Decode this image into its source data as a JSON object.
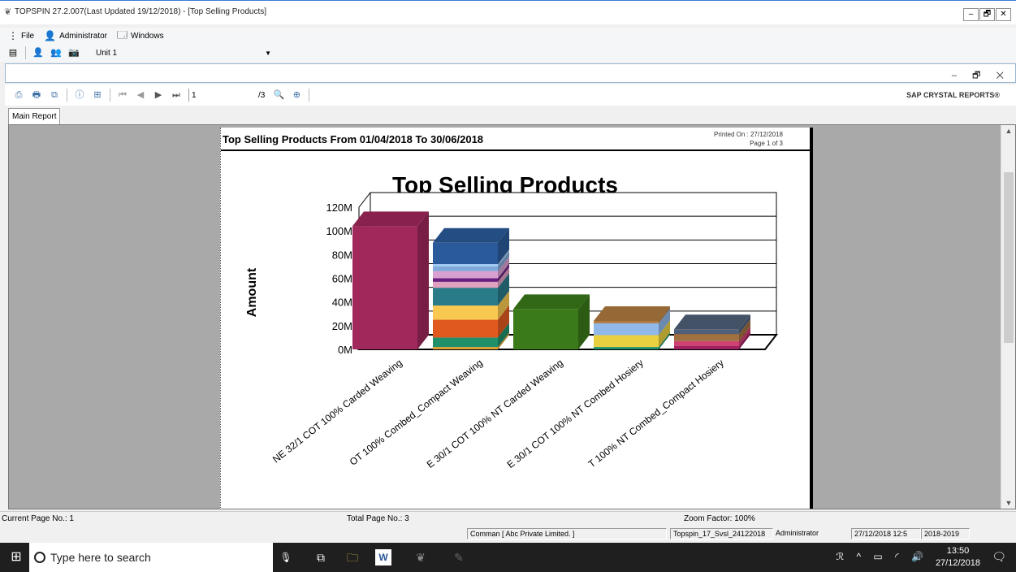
{
  "window": {
    "title": "TOPSPIN 27.2.007(Last Updated 19/12/2018) - [Top Selling Products]",
    "min": "–",
    "max": "🗗",
    "close": "✕"
  },
  "menu": {
    "file": "File",
    "admin": "Administrator",
    "windows": "Windows"
  },
  "toolbar": {
    "unit": "Unit 1"
  },
  "child": {
    "controls": "– 🗗 ✕"
  },
  "report_toolbar": {
    "page_value": "1",
    "page_total": "/3",
    "brand": "SAP CRYSTAL REPORTS®"
  },
  "tab": {
    "label": "Main Report"
  },
  "report": {
    "title": "Top Selling Products From 01/04/2018 To 30/06/2018",
    "printed_on": "Printed On : 27/12/2018",
    "page_of": "Page 1 of 3"
  },
  "chart_data": {
    "type": "bar",
    "title": "Top Selling Products",
    "ylabel": "Amount",
    "xlabel": "",
    "ylim": [
      0,
      120
    ],
    "yticks": [
      "0M",
      "20M",
      "40M",
      "60M",
      "80M",
      "100M",
      "120M"
    ],
    "categories": [
      "NE 32/1 COT 100%  Carded Weaving",
      "OT 100%  Combed_Compact Weaving",
      "E 30/1 COT 100%  NT Carded Weaving",
      "E 30/1 COT 100%  NT Combed Hosiery",
      "T 100%  NT Combed_Compact Hosiery"
    ],
    "stacks": [
      [
        {
          "v": 104,
          "c": "#a0285a"
        }
      ],
      [
        {
          "v": 2,
          "c": "#e0a030"
        },
        {
          "v": 8,
          "c": "#20906a"
        },
        {
          "v": 15,
          "c": "#e05a20"
        },
        {
          "v": 12,
          "c": "#f8c850"
        },
        {
          "v": 15,
          "c": "#2a7b8a"
        },
        {
          "v": 5,
          "c": "#e0a0c0"
        },
        {
          "v": 3,
          "c": "#6a2080"
        },
        {
          "v": 6,
          "c": "#d8a0d0"
        },
        {
          "v": 4,
          "c": "#80a8d8"
        },
        {
          "v": 2,
          "c": "#a0c8f0"
        },
        {
          "v": 18,
          "c": "#2a5a9a"
        }
      ],
      [
        {
          "v": 34,
          "c": "#3a7a1a"
        }
      ],
      [
        {
          "v": 2,
          "c": "#20906a"
        },
        {
          "v": 10,
          "c": "#e8d040"
        },
        {
          "v": 10,
          "c": "#90b8e8"
        },
        {
          "v": 2,
          "c": "#b07a40"
        }
      ],
      [
        {
          "v": 3,
          "c": "#a02060"
        },
        {
          "v": 4,
          "c": "#d04070"
        },
        {
          "v": 6,
          "c": "#a07040"
        },
        {
          "v": 4,
          "c": "#50607a"
        }
      ]
    ]
  },
  "status": {
    "current_page": "Current Page No.: 1",
    "total_page": "Total Page No.: 3",
    "zoom": "Zoom Factor: 100%",
    "company": "Comman [ Abc Private Limited. ]",
    "db": "Topspin_17_Svsl_24122018",
    "user": "Administrator",
    "datetime": "27/12/2018 12:5",
    "year": "2018-2019"
  },
  "taskbar": {
    "search_placeholder": "Type here to search",
    "time": "13:50",
    "date": "27/12/2018"
  }
}
